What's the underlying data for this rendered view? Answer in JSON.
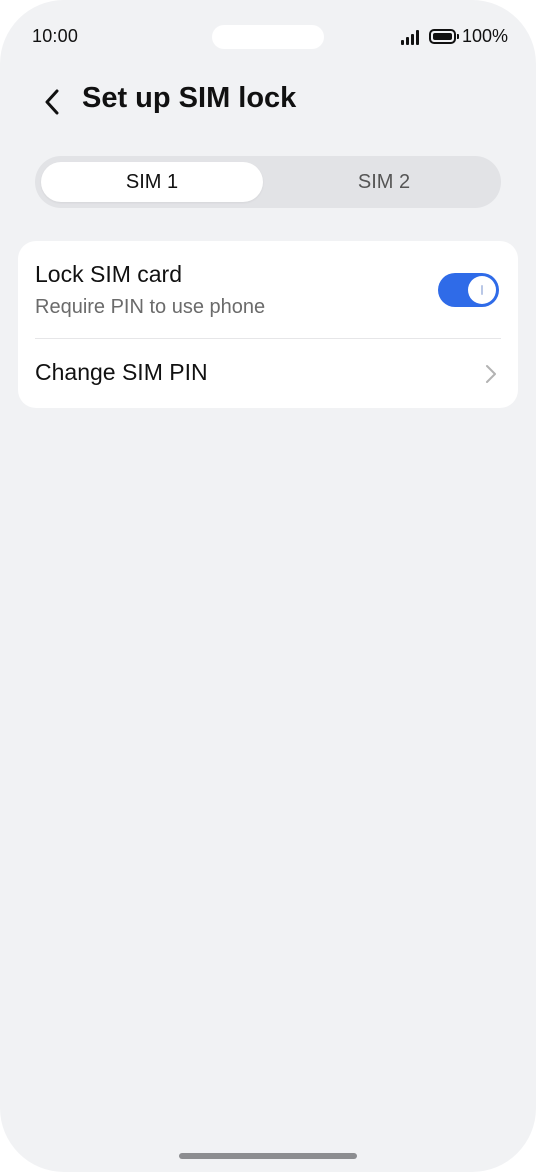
{
  "status_bar": {
    "time": "10:00",
    "battery": "100%"
  },
  "header": {
    "title": "Set up SIM lock"
  },
  "sim_tabs": [
    {
      "label": "SIM 1",
      "selected": true
    },
    {
      "label": "SIM 2",
      "selected": false
    }
  ],
  "settings": {
    "lock_sim": {
      "title": "Lock SIM card",
      "subtitle": "Require PIN to use phone",
      "enabled": true
    },
    "change_pin": {
      "title": "Change SIM PIN"
    }
  },
  "colors": {
    "accent": "#2f6be8",
    "background": "#f1f2f4"
  },
  "icons": {
    "back": "chevron-left-icon",
    "row_arrow": "chevron-right-icon"
  }
}
